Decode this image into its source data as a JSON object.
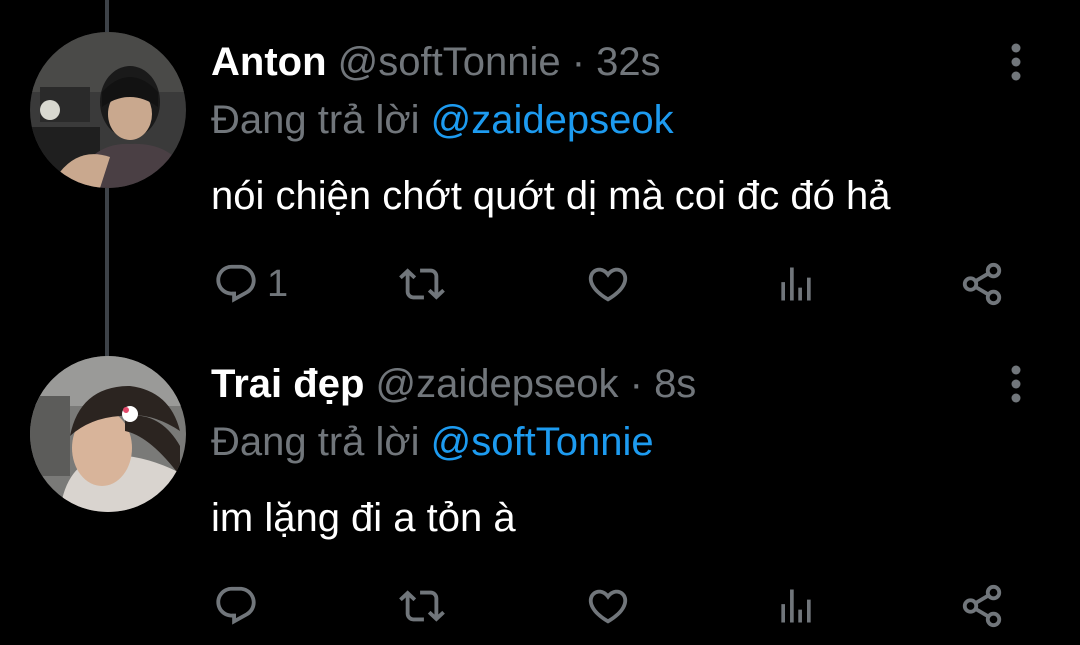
{
  "colors": {
    "background": "#000000",
    "name": "#ffffff",
    "muted": "#71767b",
    "mention": "#1d9bf0",
    "thread_line": "#3d4248"
  },
  "tweets": [
    {
      "name": "Anton",
      "handle": "@softTonnie",
      "dot": "·",
      "time": "32s",
      "reply_prefix": "Đang trả lời",
      "reply_to": "@zaidepseok",
      "text": "nói chiện chớt quớt dị mà coi đc đó hả",
      "reply_count": "1",
      "icons": [
        "reply-icon",
        "retweet-icon",
        "like-icon",
        "views-icon",
        "share-icon",
        "more-icon"
      ]
    },
    {
      "name": "Trai đẹp",
      "handle": "@zaidepseok",
      "dot": "·",
      "time": "8s",
      "reply_prefix": "Đang trả lời",
      "reply_to": "@softTonnie",
      "text": "im lặng đi a tỏn à",
      "reply_count": "",
      "icons": [
        "reply-icon",
        "retweet-icon",
        "like-icon",
        "views-icon",
        "share-icon",
        "more-icon"
      ]
    }
  ]
}
